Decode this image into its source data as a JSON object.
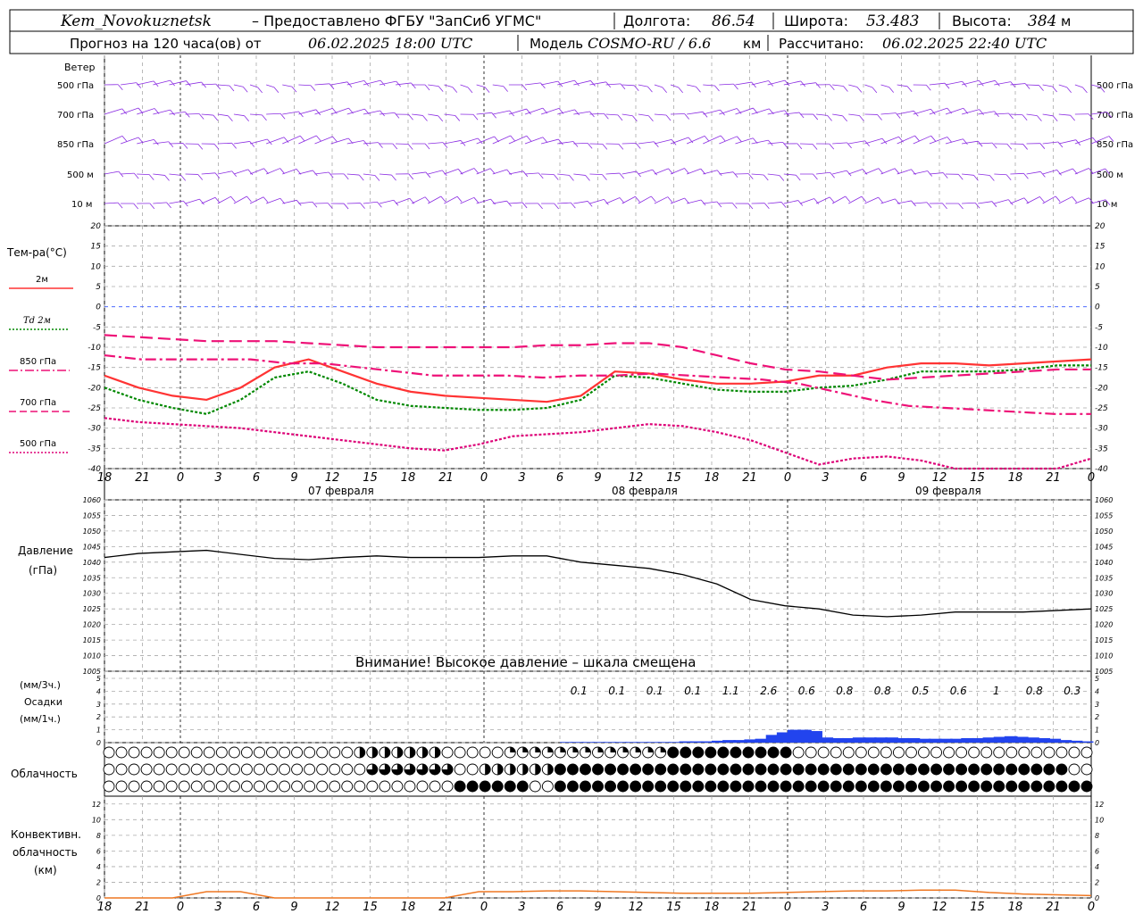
{
  "header": {
    "station": "Kem_Novokuznetsk",
    "provider": "– Предоставлено ФГБУ \"ЗапСиб УГМС\"",
    "lon_label": "Долгота:",
    "lon_value": "86.54",
    "lat_label": "Широта:",
    "lat_value": "53.483",
    "alt_label": "Высота:",
    "alt_value": "384",
    "alt_unit": "м",
    "forecast_label": "Прогноз на 120 часа(ов) от",
    "forecast_start": "06.02.2025 18:00 UTC",
    "model_label": "Модель",
    "model_name": "COSMO-RU / 6.6",
    "model_unit": "км",
    "calc_label": "Рассчитано:",
    "calc_time": "06.02.2025 22:40 UTC"
  },
  "wind_panel": {
    "title": "Ветер",
    "levels": [
      "500 гПа",
      "700 гПа",
      "850 гПа",
      "500 м",
      "10 м"
    ]
  },
  "temp_panel": {
    "title": "Тем-ра(°C)",
    "legend": [
      {
        "label": "2м",
        "color": "#ff3333"
      },
      {
        "label": "Td 2м",
        "color": "#008800"
      },
      {
        "label": "850 гПа",
        "color": "#ee1177"
      },
      {
        "label": "700 гПа",
        "color": "#ee1177"
      },
      {
        "label": "500 гПа",
        "color": "#dd0077"
      }
    ]
  },
  "pressure_panel": {
    "title": "Давление",
    "unit": "(гПа)",
    "warning": "Внимание! Высокое давление – шкала смещена"
  },
  "precip_panel": {
    "unit3": "(мм/3ч.)",
    "title": "Осадки",
    "unit1": "(мм/1ч.)"
  },
  "cloud_panel": {
    "title": "Облачность"
  },
  "conv_panel": {
    "title1": "Конвективн.",
    "title2": "облачность",
    "unit": "(км)"
  },
  "date_labels": [
    "07 февраля",
    "08 февраля",
    "09 февраля"
  ],
  "hour_labels": [
    "18",
    "21",
    "0",
    "3",
    "6",
    "9",
    "12",
    "15",
    "18",
    "21",
    "0",
    "3",
    "6",
    "9",
    "12",
    "15",
    "18",
    "21",
    "0",
    "3",
    "6",
    "9",
    "12",
    "15",
    "18",
    "21",
    "0"
  ],
  "chart_data": [
    {
      "type": "line",
      "name": "temperature",
      "x_hours": [
        0,
        3,
        6,
        9,
        12,
        15,
        18,
        21,
        24,
        27,
        30,
        33,
        36,
        39,
        42,
        45,
        48,
        51,
        54,
        57,
        60,
        63,
        66,
        69,
        72,
        75,
        78
      ],
      "ylim": [
        -40,
        20
      ],
      "yticks": [
        20,
        15,
        10,
        5,
        0,
        -5,
        -10,
        -15,
        -20,
        -25,
        -30,
        -35,
        -40
      ],
      "series": [
        {
          "name": "2м",
          "color": "#ff3333",
          "style": "solid",
          "values": [
            -17,
            -20,
            -22,
            -23,
            -20,
            -15,
            -13,
            -16,
            -19,
            -21,
            -22,
            -22.5,
            -23,
            -23.5,
            -22,
            -16,
            -16.5,
            -18,
            -19,
            -19,
            -18.5,
            -17,
            -17,
            -15,
            -14,
            -14,
            -14.5,
            -14,
            -13.5,
            -13
          ]
        },
        {
          "name": "Td 2м",
          "color": "#008800",
          "style": "dotted",
          "values": [
            -20,
            -23,
            -25,
            -26.5,
            -23,
            -17.5,
            -16,
            -19,
            -23,
            -24.5,
            -25,
            -25.5,
            -25.5,
            -25,
            -23,
            -17,
            -17.5,
            -19,
            -20.5,
            -21,
            -21,
            -20,
            -19.5,
            -18,
            -16,
            -16,
            -16,
            -15.5,
            -14.5,
            -14.5
          ]
        },
        {
          "name": "850 гПа",
          "color": "#ee1177",
          "style": "dashdot",
          "values": [
            -12,
            -13,
            -13,
            -13,
            -13,
            -14,
            -14,
            -15,
            -16,
            -17,
            -17,
            -17,
            -17.5,
            -17,
            -17,
            -16.5,
            -17,
            -17.5,
            -18,
            -19,
            -21,
            -23,
            -24.5,
            -25,
            -25.5,
            -26,
            -26.5,
            -26.5
          ]
        },
        {
          "name": "700 гПа",
          "color": "#ee1177",
          "style": "dashed",
          "values": [
            -7,
            -7.5,
            -8,
            -8.5,
            -8.5,
            -8.5,
            -9,
            -9.5,
            -10,
            -10,
            -10,
            -10,
            -10,
            -9.5,
            -9.5,
            -9,
            -9,
            -10,
            -12,
            -14,
            -15.5,
            -16,
            -17,
            -18,
            -17.5,
            -17,
            -16.5,
            -16,
            -15.5,
            -15.5
          ]
        },
        {
          "name": "500 гПа",
          "color": "#dd0077",
          "style": "dotted",
          "values": [
            -27.5,
            -28.5,
            -29,
            -29.5,
            -30,
            -31,
            -32,
            -33,
            -34,
            -35,
            -35.5,
            -34,
            -32,
            -31.5,
            -31,
            -30,
            -29,
            -29.5,
            -31,
            -33,
            -36,
            -39,
            -37.5,
            -37,
            -38,
            -40,
            -41,
            -41,
            -40,
            -37.5
          ]
        }
      ]
    },
    {
      "type": "line",
      "name": "pressure",
      "x_hours": [
        0,
        3,
        6,
        9,
        12,
        15,
        18,
        21,
        24,
        27,
        30,
        33,
        36,
        39,
        42,
        45,
        48,
        51,
        54,
        57,
        60,
        63,
        66,
        69,
        72,
        75,
        78
      ],
      "ylim": [
        1005,
        1060
      ],
      "yticks": [
        1060,
        1055,
        1050,
        1045,
        1040,
        1035,
        1030,
        1025,
        1020,
        1015,
        1010,
        1005
      ],
      "series": [
        {
          "name": "pressure",
          "color": "#000000",
          "values": [
            1041.5,
            1042.8,
            1043.3,
            1043.8,
            1042.5,
            1041.2,
            1040.8,
            1041.5,
            1042,
            1041.5,
            1041.5,
            1041.5,
            1042,
            1042,
            1040,
            1039,
            1038,
            1036,
            1033,
            1028,
            1026,
            1025,
            1023,
            1022.5,
            1023,
            1024,
            1024,
            1024,
            1024.5,
            1025
          ]
        }
      ]
    },
    {
      "type": "bar",
      "name": "precipitation",
      "ylim": [
        0,
        5
      ],
      "yticks": [
        5,
        4,
        3,
        2,
        1,
        0
      ],
      "labels_3h": [
        "0.1",
        "0.1",
        "0.1",
        "0.1",
        "1.1",
        "2.6",
        "0.6",
        "0.8",
        "0.8",
        "0.5",
        "0.6",
        "1",
        "0.8",
        "0.3"
      ],
      "hourly_values": [
        0.05,
        0.05,
        0.05,
        0.05,
        0.05,
        0.05,
        0.05,
        0.05,
        0.05,
        0.05,
        0.05,
        0.1,
        0.1,
        0.1,
        0.15,
        0.2,
        0.2,
        0.25,
        0.3,
        0.6,
        0.8,
        1.0,
        1.0,
        0.9,
        0.4,
        0.35,
        0.35,
        0.4,
        0.4,
        0.4,
        0.4,
        0.35,
        0.35,
        0.3,
        0.3,
        0.3,
        0.3,
        0.35,
        0.35,
        0.4,
        0.45,
        0.5,
        0.45,
        0.4,
        0.35,
        0.3,
        0.2,
        0.15,
        0.1
      ]
    },
    {
      "type": "area",
      "name": "convective_cloud",
      "ylim": [
        0,
        13
      ],
      "yticks": [
        12,
        10,
        8,
        6,
        4,
        2,
        0
      ],
      "series": [
        {
          "name": "convective",
          "color": "#ee7722",
          "values": [
            0,
            0,
            0,
            0.8,
            0.8,
            0,
            0,
            0,
            0,
            0,
            0,
            0.8,
            0.8,
            0.9,
            0.9,
            0.8,
            0.7,
            0.6,
            0.6,
            0.6,
            0.7,
            0.8,
            0.9,
            0.9,
            1.0,
            1.0,
            0.7,
            0.5,
            0.4,
            0.3
          ]
        }
      ]
    }
  ]
}
